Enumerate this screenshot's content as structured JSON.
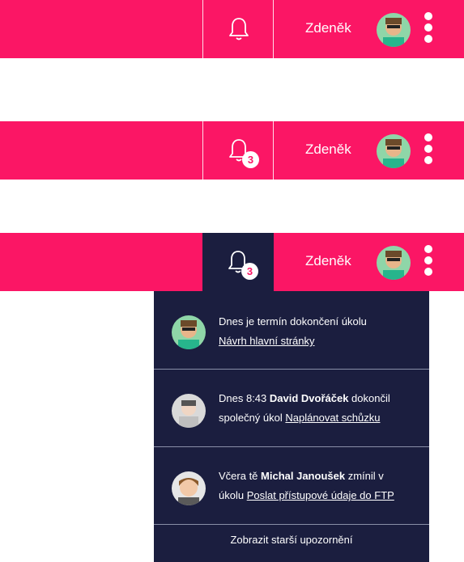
{
  "bars": [
    {
      "variant": "default",
      "user_name": "Zdeněk"
    },
    {
      "variant": "badge",
      "user_name": "Zdeněk",
      "badge_count": "3"
    },
    {
      "variant": "open",
      "user_name": "Zdeněk",
      "badge_count": "3"
    }
  ],
  "notifications": [
    {
      "line1_prefix": "Dnes je termín dokončení úkolu",
      "link": "Návrh hlavní stránky"
    },
    {
      "line1_prefix": "Dnes 8:43 ",
      "actor": "David Dvořáček",
      "line1_suffix": " dokončil",
      "line2_prefix": "společný úkol ",
      "link": "Naplánovat schůzku"
    },
    {
      "line1_prefix": "Včera tě ",
      "actor": "Michal Janoušek",
      "line1_suffix": " zmínil v",
      "line2_prefix": "úkolu ",
      "link": "Poslat přístupové údaje do FTP"
    }
  ],
  "older_label": "Zobrazit starší upozornění",
  "colors": {
    "accent": "#fb1665",
    "panel": "#1b1e3f"
  },
  "icons": [
    "bell-icon",
    "kebab-menu-icon"
  ]
}
